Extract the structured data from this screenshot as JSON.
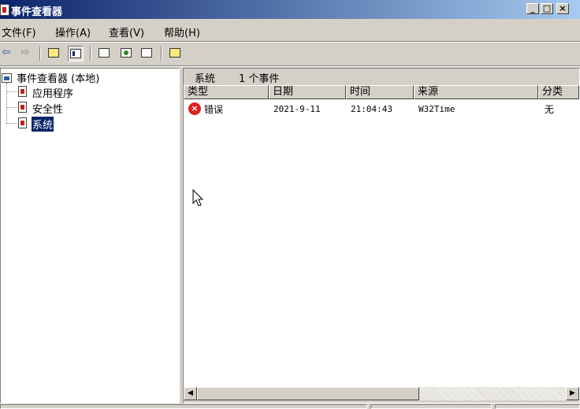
{
  "window": {
    "title": "事件查看器",
    "controls": {
      "minimize": "_",
      "maximize": "□",
      "close": "×"
    }
  },
  "menu": {
    "items": [
      {
        "label": "文件(F)"
      },
      {
        "label": "操作(A)"
      },
      {
        "label": "查看(V)"
      },
      {
        "label": "帮助(H)"
      }
    ]
  },
  "toolbar": {
    "back": "⇦",
    "forward": "⇨",
    "buttons": [
      "up-one-level-icon",
      "show-hide-tree-icon",
      "properties-icon",
      "refresh-icon",
      "export-list-icon",
      "help-icon"
    ]
  },
  "tree": {
    "root": "事件查看器 (本地)",
    "items": [
      {
        "label": "应用程序"
      },
      {
        "label": "安全性"
      },
      {
        "label": "系统",
        "selected": true
      }
    ]
  },
  "list": {
    "header_name": "系统",
    "header_count": "1 个事件",
    "columns": [
      "类型",
      "日期",
      "时间",
      "来源",
      "分类"
    ],
    "rows": [
      {
        "type_icon": "error-icon",
        "type": "错误",
        "date": "2021-9-11",
        "time": "21:04:43",
        "source": "W32Time",
        "category": "无"
      }
    ]
  },
  "colors": {
    "title_start": "#0a246a",
    "title_end": "#a6caf0",
    "selection": "#0a246a",
    "error": "#e02020"
  }
}
